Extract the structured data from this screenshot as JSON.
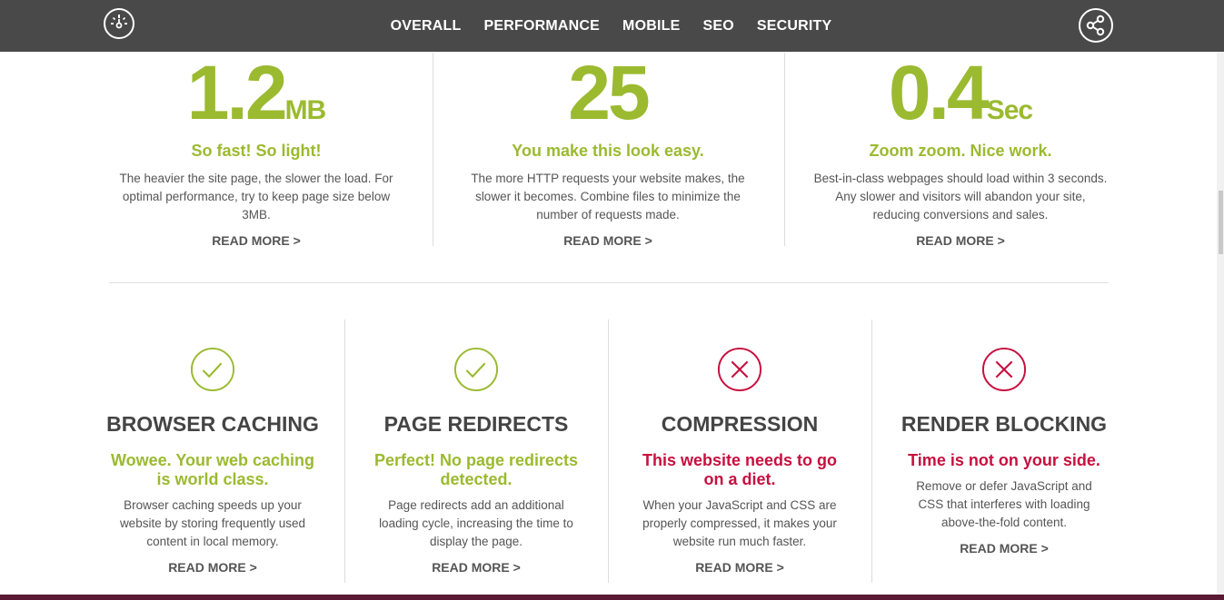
{
  "nav": {
    "logo_icon": "speedometer-icon",
    "share_icon": "share-icon",
    "items": [
      {
        "label": "OVERALL"
      },
      {
        "label": "PERFORMANCE"
      },
      {
        "label": "MOBILE"
      },
      {
        "label": "SEO"
      },
      {
        "label": "SECURITY"
      }
    ]
  },
  "metrics": [
    {
      "value": "1.2",
      "unit": "MB",
      "headline": "So fast! So light!",
      "desc": "The heavier the site page, the slower the load. For optimal performance, try to keep page size below 3MB.",
      "read_more": "READ MORE >"
    },
    {
      "value": "25",
      "unit": "",
      "headline": "You make this look easy.",
      "desc": "The more HTTP requests your website makes, the slower it becomes. Combine files to minimize the number of requests made.",
      "read_more": "READ MORE >"
    },
    {
      "value": "0.4",
      "unit": "Sec",
      "headline": "Zoom zoom. Nice work.",
      "desc": "Best-in-class webpages should load within 3 seconds. Any slower and visitors will abandon your site, reducing conversions and sales.",
      "read_more": "READ MORE >"
    }
  ],
  "checks": [
    {
      "icon": "check-circle-icon",
      "status": "pass",
      "title": "BROWSER CACHING",
      "headline": "Wowee. Your web caching is world class.",
      "desc": "Browser caching speeds up your website by storing frequently used content in local memory.",
      "read_more": "READ MORE >"
    },
    {
      "icon": "check-circle-icon",
      "status": "pass",
      "title": "PAGE REDIRECTS",
      "headline": "Perfect! No page redirects detected.",
      "desc": "Page redirects add an additional loading cycle, increasing the time to display the page.",
      "read_more": "READ MORE >"
    },
    {
      "icon": "x-circle-icon",
      "status": "fail",
      "title": "COMPRESSION",
      "headline": "This website needs to go on a diet.",
      "desc": "When your JavaScript and CSS are properly compressed, it makes your website run much faster.",
      "read_more": "READ MORE >"
    },
    {
      "icon": "x-circle-icon",
      "status": "fail",
      "title": "RENDER BLOCKING",
      "headline": "Time is not on your side.",
      "desc": "Remove or defer JavaScript and CSS that interferes with loading above-the-fold content.",
      "read_more": "READ MORE >"
    }
  ],
  "colors": {
    "pass": "#9bba30",
    "fail": "#c7103f",
    "topbar": "#4a4949"
  }
}
